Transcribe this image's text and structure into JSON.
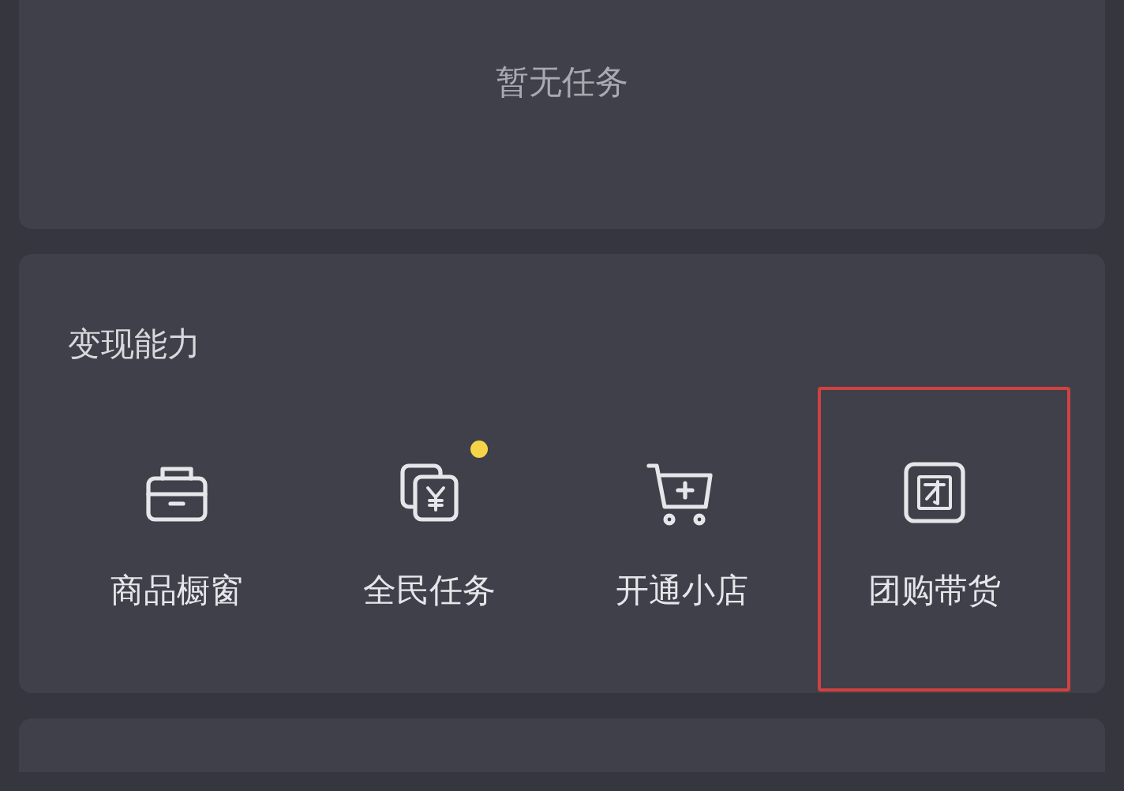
{
  "task_card": {
    "empty_text": "暂无任务"
  },
  "monetize_card": {
    "title": "变现能力",
    "items": [
      {
        "kind": "showcase",
        "label": "商品橱窗",
        "badge": false,
        "highlighted": false
      },
      {
        "kind": "tasks",
        "label": "全民任务",
        "badge": true,
        "highlighted": false
      },
      {
        "kind": "shop",
        "label": "开通小店",
        "badge": false,
        "highlighted": false
      },
      {
        "kind": "group",
        "label": "团购带货",
        "badge": false,
        "highlighted": true
      }
    ]
  }
}
